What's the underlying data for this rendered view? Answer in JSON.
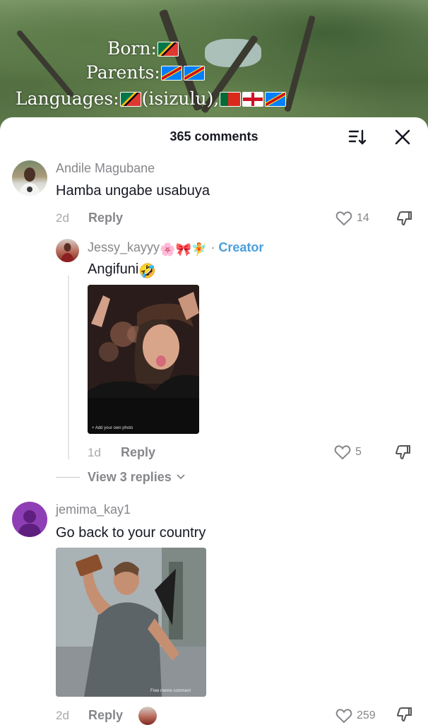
{
  "video": {
    "line1_label": "Born:",
    "line2_label": "Parents:",
    "line3_label": "Languages:",
    "line3_lang": "(isizulu),",
    "flags": [
      "south-africa",
      "congo",
      "congo",
      "south-africa",
      "portugal",
      "england",
      "congo"
    ]
  },
  "sheet": {
    "title": "365 comments",
    "sort_icon": "sort-icon",
    "close_icon": "close-icon"
  },
  "comments": [
    {
      "username": "Andile Magubane",
      "text": "Hamba ungabe usabuya",
      "time": "2d",
      "reply_label": "Reply",
      "likes": "14"
    },
    {
      "username": "jemima_kay1",
      "text": "Go back to your country",
      "time": "2d",
      "reply_label": "Reply",
      "likes": "259"
    }
  ],
  "reply": {
    "username": "Jessy_kayyy",
    "username_emojis": "🌸🎀🧚",
    "separator": "·",
    "badge": "Creator",
    "text": "Angifuni",
    "text_emoji": "🤣",
    "gif_caption": "+ Add your own photo",
    "time": "1d",
    "reply_label": "Reply",
    "likes": "5"
  },
  "view_replies": "View 3 replies",
  "gif2_watermark": "Free meme comment",
  "colors": {
    "text_primary": "#161823",
    "text_secondary": "#86878b",
    "creator": "#4a9fdc",
    "avatar_purple": "#8e3fb5"
  }
}
